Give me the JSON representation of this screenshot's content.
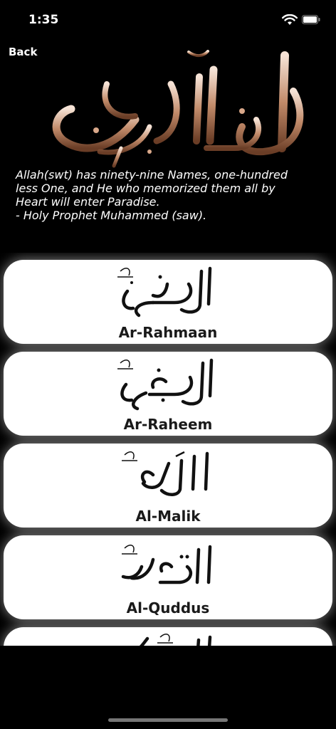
{
  "status": {
    "time": "1:35"
  },
  "nav": {
    "back_label": "Back"
  },
  "header": {
    "hadith_lines": [
      "Allah(swt) has ninety-nine Names, one-hundred",
      "less One, and He who memorized them all by",
      "Heart will enter Paradise.",
      "- Holy Prophet Muhammed (saw)."
    ]
  },
  "names": [
    {
      "name": "Ar-Rahmaan"
    },
    {
      "name": "Ar-Raheem"
    },
    {
      "name": "Al-Malik"
    },
    {
      "name": "Al-Quddus"
    },
    {
      "name": ""
    }
  ],
  "colors": {
    "background": "#000000",
    "card": "#ffffff",
    "text_dark": "#1a1a1a",
    "copper": "#b07a5a"
  }
}
